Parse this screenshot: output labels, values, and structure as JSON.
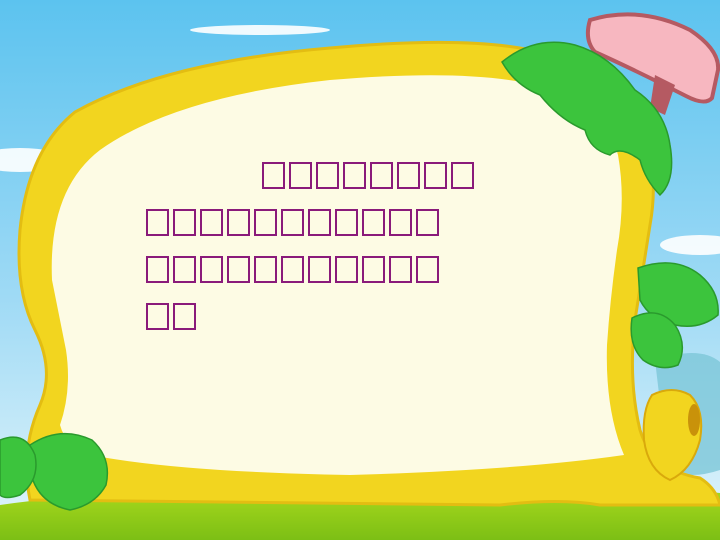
{
  "colors": {
    "sky_top": "#5cc3ef",
    "sky_bottom": "#d9f2fb",
    "frame_yellow": "#f2d51f",
    "frame_inner": "#fdfbe4",
    "leaf_green": "#3cc43d",
    "grass_green": "#8fcf17",
    "sign_pink": "#f7b7c0",
    "text_purple": "#8a1a7a"
  },
  "content": {
    "lines": [
      {
        "glyph_count": 8,
        "indented": true
      },
      {
        "glyph_count": 11,
        "indented": false
      },
      {
        "glyph_count": 11,
        "indented": false
      },
      {
        "glyph_count": 2,
        "indented": false
      }
    ]
  },
  "decorations": {
    "frame": "yellow-cartoon-frame",
    "sign": "pink-sign-icon",
    "leaves": "green-leaf-icon",
    "clouds": "cloud-icon",
    "ground": "grass-ground"
  }
}
